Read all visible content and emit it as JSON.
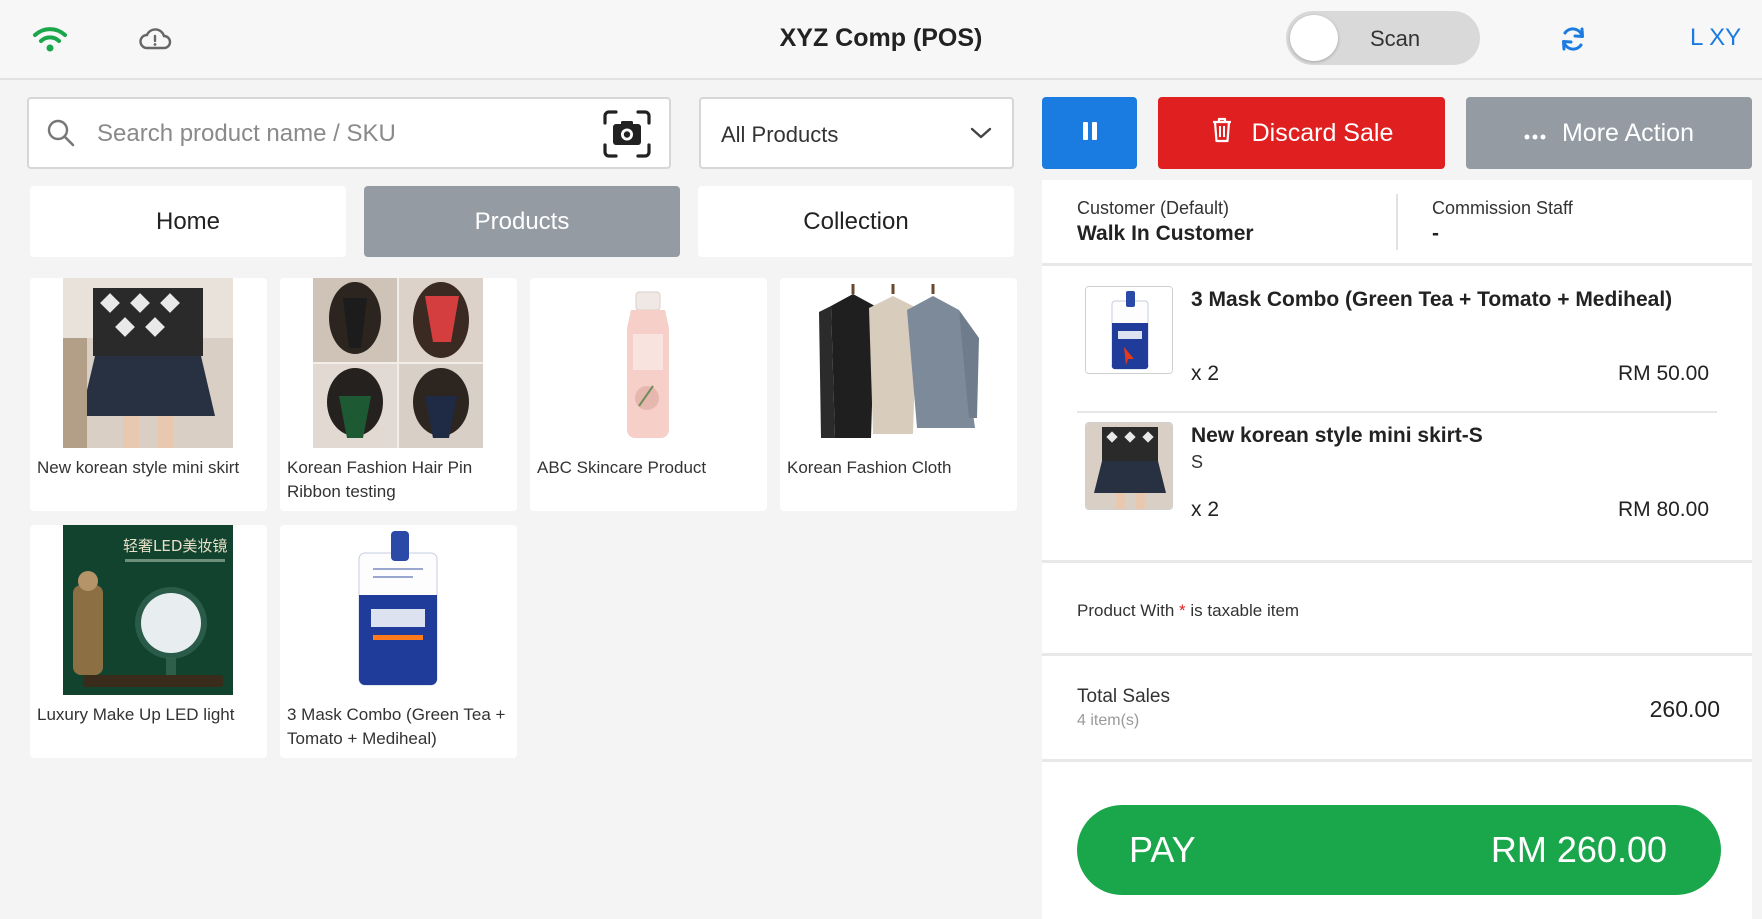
{
  "header": {
    "title": "XYZ Comp (POS)",
    "scan_label": "Scan",
    "user_label": "L XY",
    "wifi_color": "#1aa64a",
    "accent": "#1a7be0"
  },
  "search": {
    "placeholder": "Search product name / SKU",
    "value": ""
  },
  "filter": {
    "selected": "All Products"
  },
  "tabs": [
    {
      "label": "Home"
    },
    {
      "label": "Products"
    },
    {
      "label": "Collection"
    }
  ],
  "products": [
    {
      "name": "New korean style mini skirt"
    },
    {
      "name": "Korean Fashion Hair Pin Ribbon testing"
    },
    {
      "name": "ABC Skincare Product"
    },
    {
      "name": "Korean Fashion Cloth"
    },
    {
      "name": "Luxury Make Up LED light"
    },
    {
      "name": "3 Mask Combo (Green Tea + Tomato + Mediheal)"
    }
  ],
  "actions": {
    "discard_label": "Discard Sale",
    "more_label": "More Action",
    "discard_color": "#e02020"
  },
  "customer": {
    "label": "Customer  (Default)",
    "value": "Walk In Customer",
    "staff_label": "Commission Staff",
    "staff_value": "-"
  },
  "cart": [
    {
      "name": "3 Mask Combo (Green Tea + Tomato + Mediheal)",
      "variant": "",
      "qty": "x 2",
      "price": "RM 50.00"
    },
    {
      "name": "New korean style mini skirt-S",
      "variant": "S",
      "qty": "x 2",
      "price": "RM 80.00"
    }
  ],
  "tax_note": {
    "before": "Product With",
    "star": "*",
    "after": "is taxable item"
  },
  "totals": {
    "label": "Total Sales",
    "count": "4 item(s)",
    "value": "260.00"
  },
  "pay": {
    "label": "PAY",
    "amount": "RM 260.00",
    "color": "#1aa64a"
  }
}
